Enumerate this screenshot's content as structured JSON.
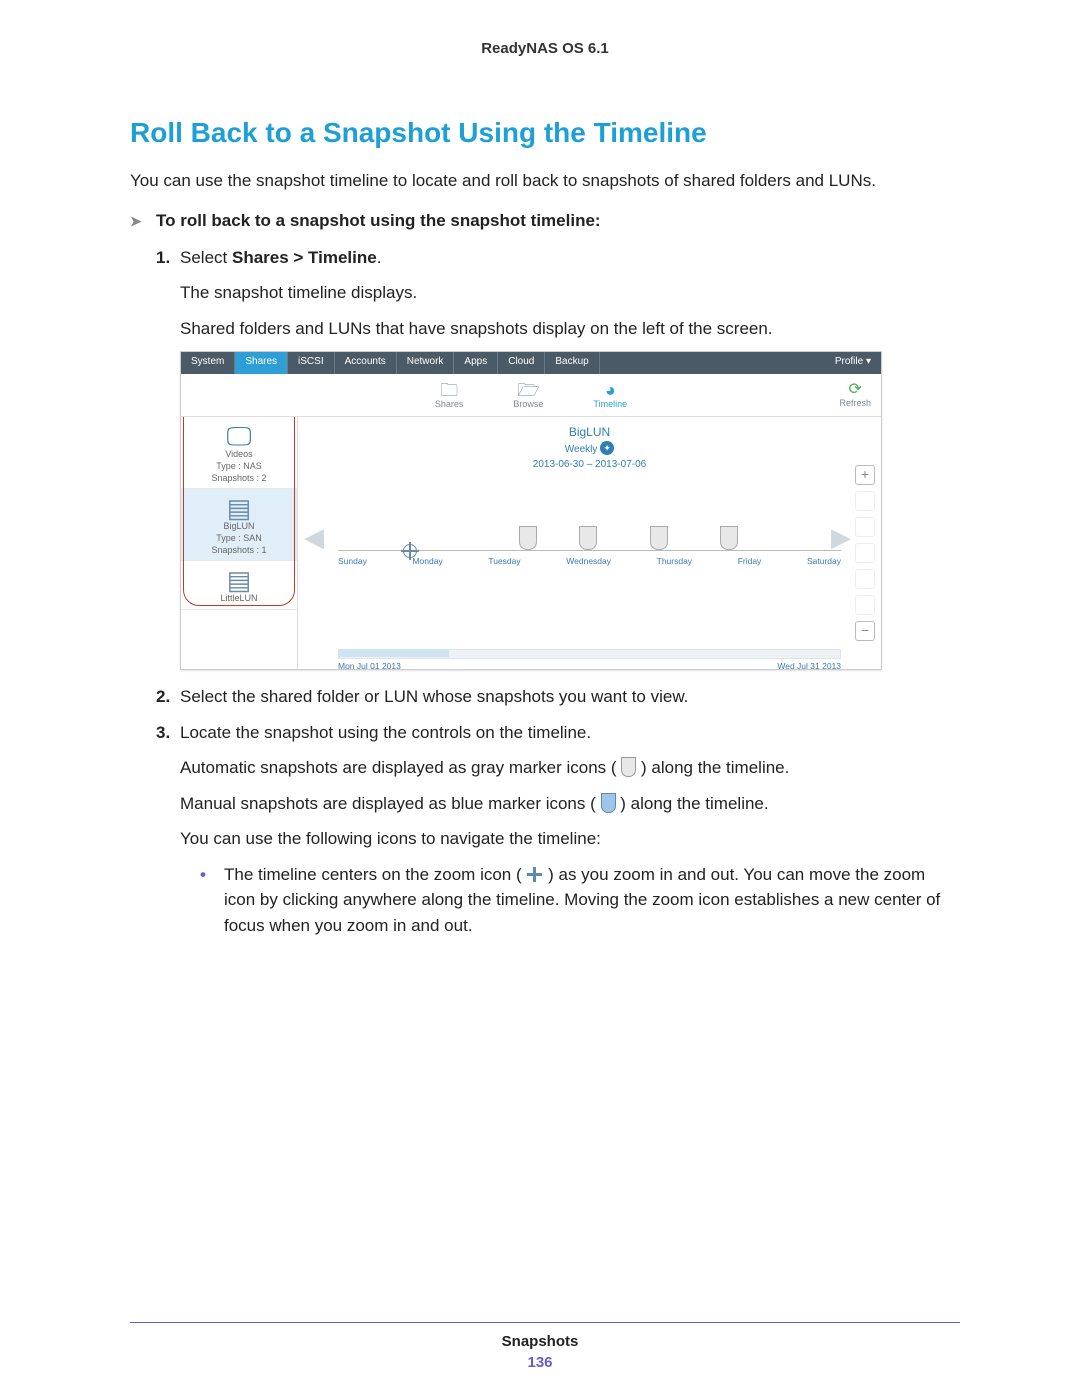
{
  "header_product": "ReadyNAS OS 6.1",
  "section_title": "Roll Back to a Snapshot Using the Timeline",
  "intro": "You can use the snapshot timeline to locate and roll back to snapshots of shared folders and LUNs.",
  "procedure_heading": "To roll back to a snapshot using the snapshot timeline:",
  "steps": {
    "s1_num": "1.",
    "s1_a": "Select ",
    "s1_b": "Shares > Timeline",
    "s1_c": ".",
    "s1_sub1": "The snapshot timeline displays.",
    "s1_sub2": "Shared folders and LUNs that have snapshots display on the left of the screen.",
    "s2_num": "2.",
    "s2": "Select the shared folder or LUN whose snapshots you want to view.",
    "s3_num": "3.",
    "s3": "Locate the snapshot using the controls on the timeline.",
    "s3_sub1a": "Automatic snapshots are displayed as gray marker icons (",
    "s3_sub1b": ") along the timeline.",
    "s3_sub2a": "Manual snapshots are displayed as blue marker icons (",
    "s3_sub2b": ") along the timeline.",
    "s3_sub3": "You can use the following icons to navigate the timeline:",
    "bullet1a": "The timeline centers on the zoom icon (",
    "bullet1b": ") as you zoom in and out. You can move the zoom icon by clicking anywhere along the timeline. Moving the zoom icon establishes a new center of focus when you zoom in and out."
  },
  "screenshot": {
    "tabs": [
      "System",
      "Shares",
      "iSCSI",
      "Accounts",
      "Network",
      "Apps",
      "Cloud",
      "Backup"
    ],
    "profile": "Profile ▾",
    "toolbar": {
      "shares": "Shares",
      "browse": "Browse",
      "timeline": "Timeline",
      "refresh": "Refresh"
    },
    "left": {
      "card1": {
        "name": "Videos",
        "type": "Type : NAS",
        "snaps": "Snapshots : 2"
      },
      "card2": {
        "name": "BigLUN",
        "type": "Type : SAN",
        "snaps": "Snapshots : 1"
      },
      "card3": {
        "name": "LittleLUN"
      }
    },
    "main": {
      "title": "BigLUN",
      "range_label": "Weekly",
      "range": "2013-06-30 – 2013-07-06",
      "days": [
        "Sunday",
        "Monday",
        "Tuesday",
        "Wednesday",
        "Thursday",
        "Friday",
        "Saturday"
      ],
      "scrub_start": "Mon Jul 01 2013",
      "scrub_end": "Wed Jul 31 2013",
      "plus": "+",
      "minus": "−"
    }
  },
  "footer_label": "Snapshots",
  "footer_page": "136"
}
